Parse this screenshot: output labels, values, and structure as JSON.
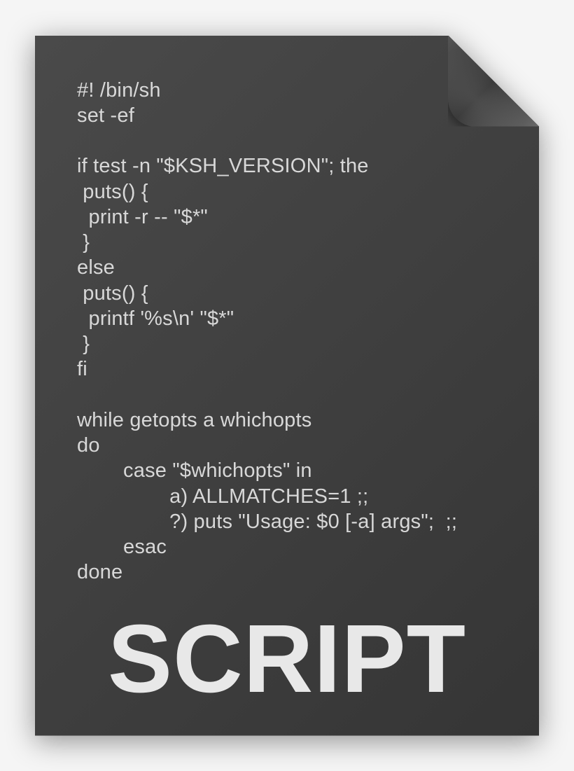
{
  "code_lines": "#! /bin/sh\nset -ef\n\nif test -n \"$KSH_VERSION\"; the\n puts() {\n  print -r -- \"$*\"\n }\nelse\n puts() {\n  printf '%s\\n' \"$*\"\n }\nfi\n\nwhile getopts a whichopts\ndo\n        case \"$whichopts\" in\n                a) ALLMATCHES=1 ;;\n                ?) puts \"Usage: $0 [-a] args\";  ;;\n        esac\ndone",
  "label": "SCRIPT"
}
